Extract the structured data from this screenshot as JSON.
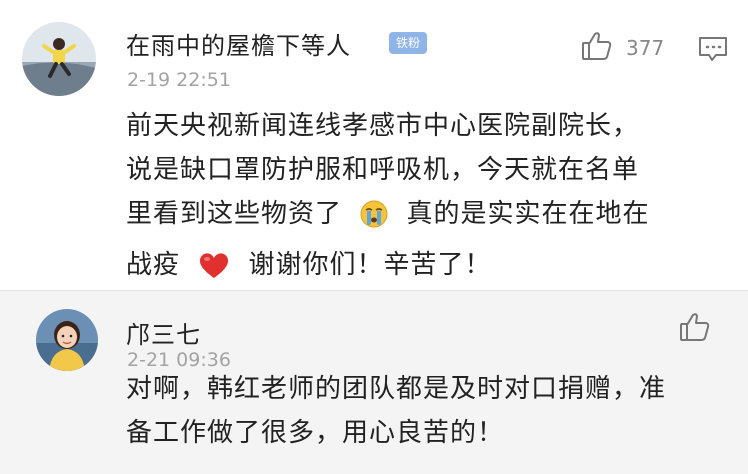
{
  "comment": {
    "username": "在雨中的屋檐下等人",
    "badge": "铁粉",
    "timestamp": "2-19 22:51",
    "like_count": "377",
    "text_lines": [
      "前天央视新闻连线孝感市中心医院副院长，",
      "说是缺口罩防护服和呼吸机，今天就在名单",
      "里看到这些物资了",
      "真的是实实在在地在",
      "战疫",
      "谢谢你们！辛苦了！"
    ],
    "emojis": [
      "crying-face-emoji",
      "red-heart-emoji"
    ]
  },
  "reply": {
    "username": "邝三七",
    "timestamp": "2-21 09:36",
    "text_lines": [
      "对啊，韩红老师的团队都是及时对口捐赠，准",
      "备工作做了很多，用心良苦的！"
    ]
  },
  "colors": {
    "text": "#222222",
    "meta": "#a3a3a3",
    "badge_bg": "#8fb4e8",
    "reply_bg": "#f4f4f4",
    "heart": "#e0312f",
    "emoji_face": "#f6c33b",
    "tears": "#5aa9e6"
  },
  "icons": [
    "thumbs-up-icon",
    "comment-more-icon"
  ]
}
